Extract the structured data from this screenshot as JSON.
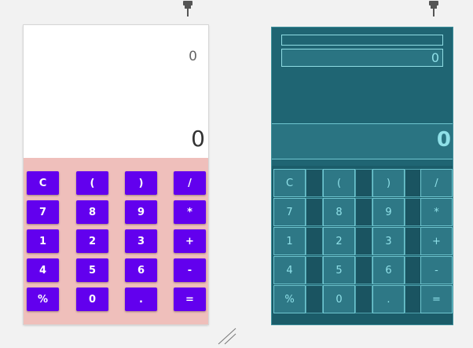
{
  "design": {
    "expression": "0",
    "result": "0",
    "keys": [
      [
        "C",
        "(",
        ")",
        "/"
      ],
      [
        "7",
        "8",
        "9",
        "*"
      ],
      [
        "1",
        "2",
        "3",
        "+"
      ],
      [
        "4",
        "5",
        "6",
        "-"
      ],
      [
        "%",
        "0",
        ".",
        "="
      ]
    ]
  },
  "blueprint": {
    "expression": "0",
    "result": "0",
    "keys": [
      [
        "C",
        "(",
        ")",
        "/"
      ],
      [
        "7",
        "8",
        "9",
        "*"
      ],
      [
        "1",
        "2",
        "3",
        "+"
      ],
      [
        "4",
        "5",
        "6",
        "-"
      ],
      [
        "%",
        "0",
        ".",
        "="
      ]
    ]
  },
  "colors": {
    "key_purple": "#6200ee",
    "keypad_pink": "#efbfbb",
    "blueprint_bg": "#1f6573",
    "blueprint_line": "#6fc6d0"
  },
  "icons": [
    "pin-icon",
    "resize-handle-icon"
  ]
}
